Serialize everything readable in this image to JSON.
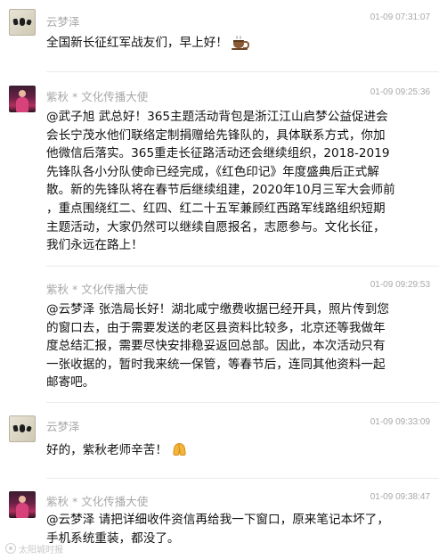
{
  "messages": [
    {
      "sender": "云梦泽",
      "time": "01-09 07:31:07",
      "lines": [
        "全国新长征红军战友们，早上好！"
      ],
      "emoji": "☕",
      "emoji_name": "coffee-icon"
    },
    {
      "sender": "紫秋 * 文化传播大使",
      "time": "01-09 09:25:36",
      "lines": [
        "@武子旭 武总好！365主题活动背包是浙江江山启梦公益促进会",
        "会长宁茂水他们联络定制捐赠给先锋队的，具体联系方式，你加",
        "他微信后落实。365重走长征路活动还会继续组织，2018-2019",
        "先锋队各小分队使命已经完成，《红色印记》年度盛典后正式解",
        "散。新的先锋队将在春节后继续组建，2020年10月三军大会师前",
        "，重点围绕红二、红四、红二十五军兼顾红西路军线路组织短期",
        "主题活动，大家仍然可以继续自愿报名，志愿参与。文化长征，",
        "我们永远在路上！"
      ]
    },
    {
      "sender": "紫秋 * 文化传播大使",
      "time": "01-09 09:29:53",
      "lines": [
        "@云梦泽 张浩局长好！湖北咸宁缴费收据已经开具，照片传到您",
        "的窗口去，由于需要发送的老区县资料比较多，北京还等我做年",
        "度总结汇报，需要尽快安排稳妥返回总部。因此，本次活动只有",
        "一张收据的，暂时我来统一保管，等春节后，连同其他资料一起",
        "邮寄吧。"
      ]
    },
    {
      "sender": "云梦泽",
      "time": "01-09 09:33:09",
      "lines": [
        "好的，紫秋老师辛苦！"
      ],
      "emoji": "🙏",
      "emoji_name": "praying-hands-icon"
    },
    {
      "sender": "紫秋 * 文化传播大使",
      "time": "01-09 09:38:47",
      "lines": [
        "@云梦泽 请把详细收件资信再给我一下窗口，原来笔记本坏了，",
        "手机系统重装，都没了。"
      ]
    }
  ],
  "watermark": "太阳城时报"
}
